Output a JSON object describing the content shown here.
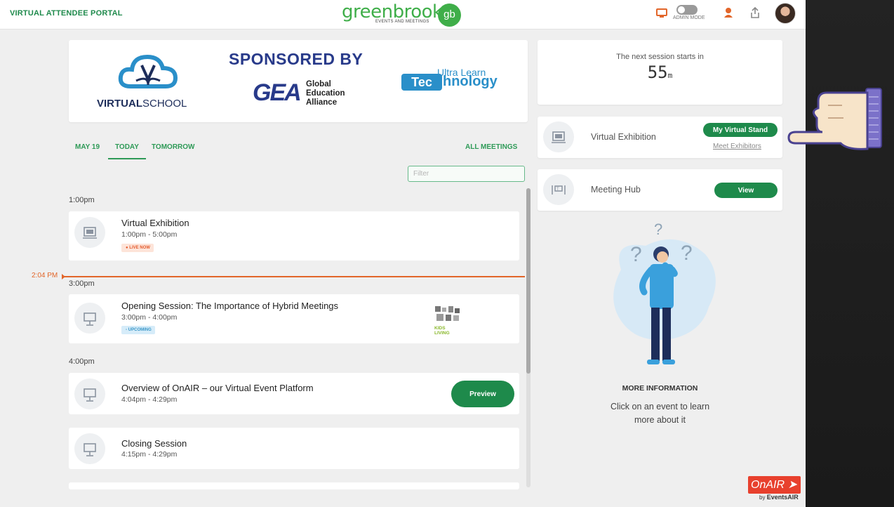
{
  "header": {
    "portal_title": "VIRTUAL ATTENDEE PORTAL",
    "logo_word": "greenbrook",
    "logo_sub": "EVENTS AND MEETINGS",
    "logo_badge": "gb",
    "admin_mode_label": "ADMIN MODE"
  },
  "sponsor": {
    "heading": "SPONSORED BY",
    "virtual_school_bold": "VIRTUAL",
    "virtual_school_light": "SCHOOL",
    "gea_mark": "GEA",
    "gea_line1": "Global",
    "gea_line2": "Education",
    "gea_line3": "Alliance",
    "ultra_top": "Ultra Learn",
    "ultra_tec": "Tec",
    "ultra_rest": "hnology"
  },
  "tabs": {
    "may19": "MAY 19",
    "today": "TODAY",
    "tomorrow": "TOMORROW",
    "all_meetings": "ALL MEETINGS",
    "active": "TODAY"
  },
  "filter": {
    "placeholder": "Filter"
  },
  "now_marker": {
    "time": "2:04 PM"
  },
  "time_groups": [
    "1:00pm",
    "3:00pm",
    "4:00pm"
  ],
  "sessions": [
    {
      "title": "Virtual Exhibition",
      "time": "1:00pm - 5:00pm",
      "badge": "LIVE NOW"
    },
    {
      "title": "Opening Session: The Importance of Hybrid Meetings",
      "time": "3:00pm - 4:00pm",
      "badge": "UPCOMING",
      "thumb_text": "KIDS LIVING"
    },
    {
      "title": "Overview of OnAIR – our Virtual Event Platform",
      "time": "4:04pm - 4:29pm",
      "button": "Preview"
    },
    {
      "title": "Closing Session",
      "time": "4:15pm - 4:29pm"
    }
  ],
  "next_session": {
    "label": "The next session starts in",
    "value": "55",
    "unit": "m"
  },
  "exhibition": {
    "label": "Virtual Exhibition",
    "button": "My Virtual Stand",
    "link": "Meet Exhibitors"
  },
  "meeting_hub": {
    "label": "Meeting Hub",
    "button": "View"
  },
  "more_info": {
    "title": "MORE INFORMATION",
    "text": "Click on an event to learn more about it"
  },
  "brand": {
    "onair": "OnAIR",
    "by": "by",
    "eventsair": "EventsAIR"
  },
  "colors": {
    "green": "#1e8a4b",
    "now_line": "#e2662a",
    "logo_green": "#3fae49"
  },
  "icons": [
    "monitor-icon",
    "user-badge-icon",
    "share-icon",
    "exhibition-icon",
    "presentation-icon",
    "meeting-hub-icon",
    "hand-pointer-icon"
  ]
}
